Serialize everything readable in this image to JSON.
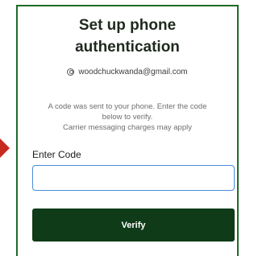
{
  "header": {
    "title_line1": "Set up phone",
    "title_line2": "authentication"
  },
  "account": {
    "icon": "user-circle-icon",
    "email": "woodchuckwanda@gmail.com"
  },
  "message": {
    "line1": "A code was sent to your phone. Enter the code",
    "line2": "below to verify.",
    "line3": "Carrier messaging charges may apply"
  },
  "form": {
    "code_label": "Enter Code",
    "code_value": "",
    "code_placeholder": "",
    "verify_label": "Verify"
  },
  "colors": {
    "accent_border": "#1e6b27",
    "button_bg": "#0f3b18",
    "input_focus": "#4b8bd8",
    "pointer_arrow": "#c62b1d"
  }
}
